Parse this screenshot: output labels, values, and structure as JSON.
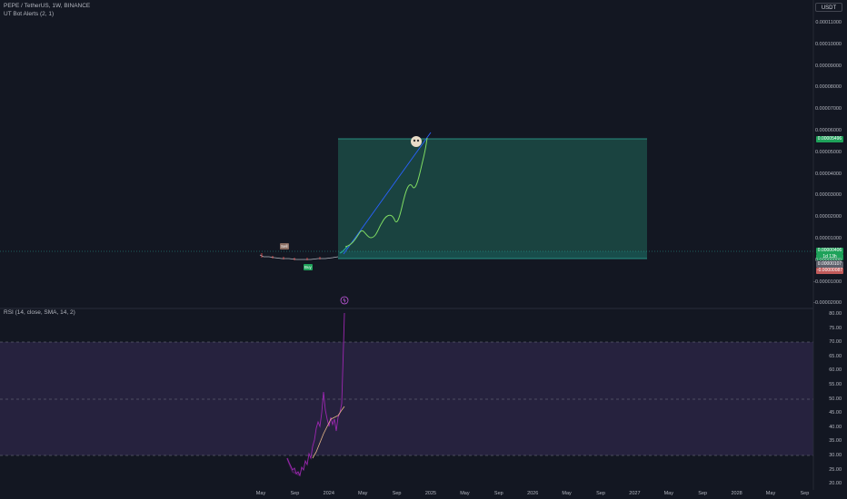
{
  "header": {
    "symbol_line": "PEPE / TetherUS, 1W, BINANCE",
    "indicator_line": "UT Bot Alerts (2, 1)",
    "rsi_line": "RSI (14, close, SMA, 14, 2)"
  },
  "currency_button": "USDT",
  "price_axis": [
    "0.00011000",
    "0.00010000",
    "0.00009000",
    "0.00008000",
    "0.00007000",
    "0.00006000",
    "0.00005000",
    "0.00004000",
    "0.00003000",
    "0.00002000",
    "0.00001000",
    "0.00000000",
    "-0.00001000",
    "-0.00002000"
  ],
  "rsi_axis": [
    "80.00",
    "75.00",
    "70.00",
    "65.00",
    "60.00",
    "55.00",
    "50.00",
    "45.00",
    "40.00",
    "35.00",
    "30.00",
    "25.00",
    "20.00"
  ],
  "time_axis": [
    "May",
    "Sep",
    "2024",
    "May",
    "Sep",
    "2025",
    "May",
    "Sep",
    "2026",
    "May",
    "Sep",
    "2027",
    "May",
    "Sep",
    "2028",
    "May",
    "Sep"
  ],
  "price_tags": {
    "target": "0.00005496",
    "current": "0.00000406",
    "countdown": "1d 13h",
    "entry": "0.00000107",
    "stop": "-0.00000087"
  },
  "signals": {
    "sell": "Sell",
    "buy": "Buy"
  },
  "colors": {
    "background": "#131722",
    "target_zone": "#1f5a52",
    "projection_line": "#7fdc63",
    "trend_line": "#2962ff",
    "rsi_line": "#9c27b0",
    "rsi_band": "#7e57c2",
    "sell": "#8a6d62",
    "buy": "#1ea25a"
  }
}
